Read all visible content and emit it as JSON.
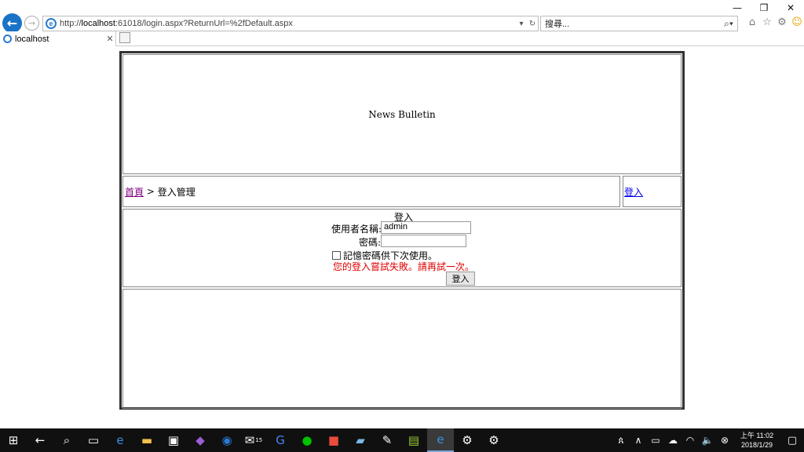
{
  "window": {
    "minimize_icon": "—",
    "restore_icon": "❐",
    "close_icon": "✕"
  },
  "address": {
    "url_prefix": "http://",
    "url_host": "localhost",
    "url_rest": ":61018/login.aspx?ReturnUrl=%2fDefault.aspx"
  },
  "search": {
    "placeholder": "搜尋..."
  },
  "tab": {
    "title": "localhost"
  },
  "page": {
    "banner": "News Bulletin",
    "breadcrumb_home": "首頁",
    "breadcrumb_sep": " > ",
    "breadcrumb_current": "登入管理",
    "login_link": "登入",
    "form": {
      "title": "登入",
      "username_label": "使用者名稱:",
      "username_value": "admin",
      "password_label": "密碼:",
      "password_value": "",
      "remember_label": "記憶密碼供下次使用。",
      "error": "您的登入嘗試失敗。請再試一次。",
      "submit": "登入"
    }
  },
  "taskbar": {
    "mail_badge": "15",
    "clock_time": "上午 11:02",
    "clock_date": "2018/1/29"
  },
  "colors": {
    "link_visited": "#800080",
    "link": "#0000ee",
    "error": "#e00000",
    "ie_blue": "#1a73c7"
  }
}
